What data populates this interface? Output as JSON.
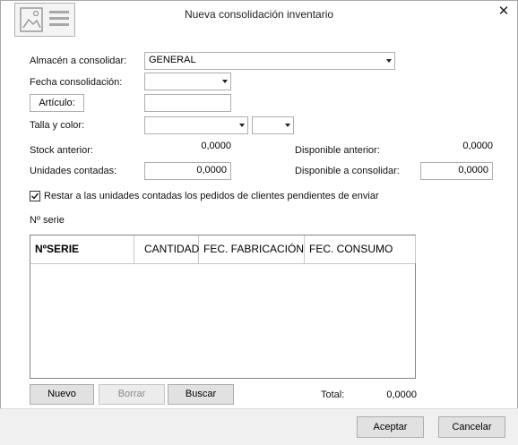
{
  "window": {
    "title": "Nueva consolidación inventario"
  },
  "form": {
    "almacen_label": "Almacén a consolidar:",
    "almacen_value": "GENERAL",
    "fecha_label": "Fecha consolidación:",
    "fecha_value": "",
    "articulo_button": "Artículo:",
    "articulo_value": "",
    "talla_label": "Talla y color:",
    "talla_value": "",
    "color_value": "",
    "stock_anterior_label": "Stock anterior:",
    "stock_anterior_value": "0,0000",
    "disponible_anterior_label": "Disponible anterior:",
    "disponible_anterior_value": "0,0000",
    "unidades_label": "Unidades contadas:",
    "unidades_value": "0,0000",
    "disponible_consolidar_label": "Disponible a consolidar:",
    "disponible_consolidar_value": "0,0000",
    "restar_checkbox_label": "Restar a las unidades contadas los pedidos de clientes pendientes de enviar",
    "restar_checked": true,
    "nserie_label": "Nº serie"
  },
  "grid": {
    "columns": [
      "NºSERIE",
      "CANTIDAD",
      "FEC. FABRICACIÓN",
      "FEC. CONSUMO"
    ],
    "rows": []
  },
  "grid_buttons": {
    "nuevo": "Nuevo",
    "borrar": "Borrar",
    "buscar": "Buscar"
  },
  "totals": {
    "label": "Total:",
    "value": "0,0000"
  },
  "footer": {
    "accept": "Aceptar",
    "cancel": "Cancelar"
  }
}
